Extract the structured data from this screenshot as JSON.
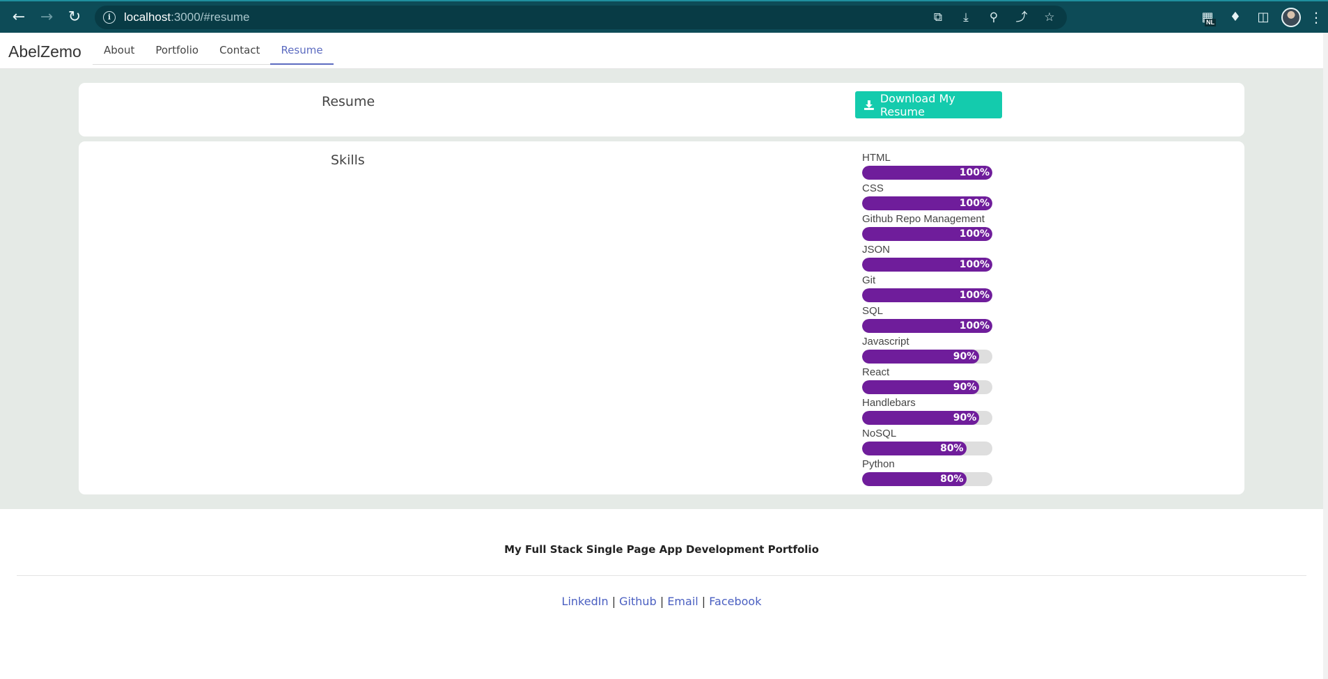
{
  "browser": {
    "url_host": "localhost",
    "url_rest": ":3000/#resume",
    "extension_badge": "NL",
    "icons": [
      "back-icon",
      "forward-icon",
      "reload-icon",
      "info-icon",
      "open-in-app-icon",
      "install-icon",
      "zoom-icon",
      "share-icon",
      "bookmark-star-icon",
      "extension-icon",
      "puzzle-icon",
      "side-panel-icon",
      "profile-avatar",
      "menu-icon"
    ]
  },
  "navbar": {
    "brand": "AbelZemo",
    "tabs": [
      {
        "label": "About"
      },
      {
        "label": "Portfolio"
      },
      {
        "label": "Contact"
      },
      {
        "label": "Resume"
      }
    ],
    "active_tab": "Resume"
  },
  "resume": {
    "title": "Resume",
    "download_label": "Download My Resume"
  },
  "skills": {
    "title": "Skills",
    "items": [
      {
        "name": "HTML",
        "percent": 100,
        "label": "100%"
      },
      {
        "name": "CSS",
        "percent": 100,
        "label": "100%"
      },
      {
        "name": "Github Repo Management",
        "percent": 100,
        "label": "100%"
      },
      {
        "name": "JSON",
        "percent": 100,
        "label": "100%"
      },
      {
        "name": "Git",
        "percent": 100,
        "label": "100%"
      },
      {
        "name": "SQL",
        "percent": 100,
        "label": "100%"
      },
      {
        "name": "Javascript",
        "percent": 90,
        "label": "90%"
      },
      {
        "name": "React",
        "percent": 90,
        "label": "90%"
      },
      {
        "name": "Handlebars",
        "percent": 90,
        "label": "90%"
      },
      {
        "name": "NoSQL",
        "percent": 80,
        "label": "80%"
      },
      {
        "name": "Python",
        "percent": 80,
        "label": "80%"
      }
    ]
  },
  "footer": {
    "title": "My Full Stack Single Page App Development Portfolio",
    "links": [
      {
        "label": "LinkedIn"
      },
      {
        "label": "Github"
      },
      {
        "label": "Email"
      },
      {
        "label": "Facebook"
      }
    ],
    "separator": "|"
  },
  "colors": {
    "accent": "#5c6bc0",
    "download_button": "#14cbad",
    "skill_bar": "#6f1d9b",
    "chrome": "#0d4b57"
  }
}
